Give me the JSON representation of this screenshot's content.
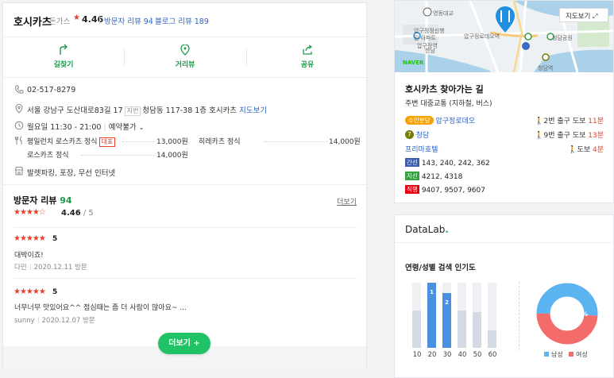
{
  "place": {
    "name": "호시카츠",
    "category": "돈가스",
    "rating_star": "★",
    "rating": "4.46",
    "visitor_reviews": "방문자 리뷰 94",
    "blog_reviews": "블로그 리뷰 189"
  },
  "actions": [
    {
      "label": "길찾기",
      "icon": "directions-icon"
    },
    {
      "label": "거리뷰",
      "icon": "location-pin-icon"
    },
    {
      "label": "공유",
      "icon": "share-icon"
    }
  ],
  "info": {
    "phone": "02-517-8279",
    "address": "서울 강남구 도산대로83길 17",
    "lot_tag": "지번",
    "lot_address": "청담동 117-38 1층 호시카츠",
    "map_link": "지도보기",
    "hours": "월요일 11:30 - 21:00",
    "reservation": "예약불가",
    "amenities": "발렛파킹, 포장, 무선 인터넷"
  },
  "menu": [
    {
      "name": "평일런치 로스카츠 정식",
      "rep": "대표",
      "price": "13,000원"
    },
    {
      "name": "히레카츠 정식",
      "price": "14,000원"
    },
    {
      "name": "로스카츠 정식",
      "price": "14,000원"
    }
  ],
  "reviews_section": {
    "title": "방문자 리뷰",
    "count": "94",
    "more": "더보기",
    "stars": "★★★★☆",
    "score": "4.46",
    "score_total": "/ 5",
    "rating_fraction": 0.892
  },
  "reviews": [
    {
      "stars": "★★★★★",
      "score": "5",
      "text": "대박이죠!",
      "author": "다민",
      "date": "2020.12.11 방문"
    },
    {
      "stars": "★★★★★",
      "score": "5",
      "text": "너무너무 맛있어요^^ 점심때는 좀 더 사람이 많아요~ ...",
      "author": "sunny",
      "date": "2020.12.07 방문"
    }
  ],
  "more_button": "더보기 +",
  "map": {
    "button": "지도보기",
    "provider": "NAVER",
    "labels": [
      "압구정로데오역",
      "압구정정신병원 아파트",
      "영동대교",
      "청담역",
      "한남",
      "압구정역",
      "청담공원"
    ]
  },
  "route": {
    "title": "호시카츠 찾아가는 길",
    "subtitle": "주변 대중교통 (지하철, 버스)",
    "subway": [
      {
        "line": "수인분당",
        "station": "압구정로데오",
        "exit": "2번 출구",
        "walk": "도보",
        "time": "11분",
        "color": "#f5a200"
      },
      {
        "line": "7",
        "station": "청담",
        "exit": "9번 출구",
        "walk": "도보",
        "time": "13분",
        "color": "#747f00"
      },
      {
        "line": "",
        "station": "프리마호텔",
        "exit": "",
        "walk": "도보",
        "time": "4분",
        "color": ""
      }
    ],
    "buses": [
      {
        "type": "간선",
        "routes": "143, 240, 242, 362",
        "color": "#3d5bab"
      },
      {
        "type": "지선",
        "routes": "4212, 4318",
        "color": "#33a23d"
      },
      {
        "type": "직행",
        "routes": "9407, 9507, 9607",
        "color": "#e60012"
      }
    ]
  },
  "datalab": {
    "logo": "DataLab",
    "title": "연령/성별 검색 인기도"
  },
  "chart_data": [
    {
      "type": "bar",
      "categories": [
        "10",
        "20",
        "30",
        "40",
        "50",
        "60"
      ],
      "values": [
        0.57,
        1.0,
        0.84,
        0.57,
        0.55,
        0.27
      ],
      "rank_labels": [
        "",
        "1",
        "2",
        "",
        "",
        ""
      ],
      "highlight_color": "#4a90e2",
      "base_color": "#d4dae3",
      "ylim": [
        0,
        1
      ]
    },
    {
      "type": "pie",
      "labels": [
        "남성",
        "여성"
      ],
      "values": [
        51,
        49
      ],
      "value_labels": [
        "51%",
        "49%"
      ],
      "colors": [
        "#5bb3f0",
        "#f36b6b"
      ]
    }
  ]
}
